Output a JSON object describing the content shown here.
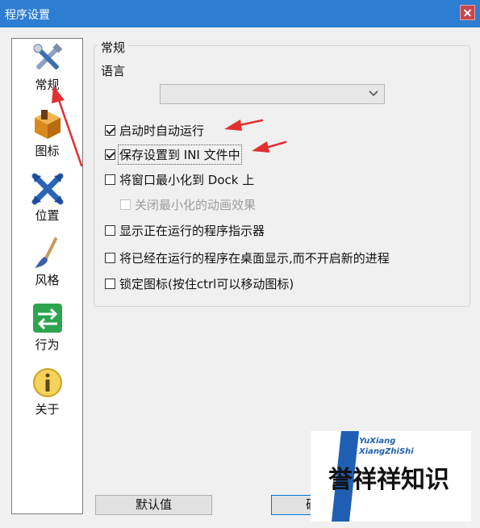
{
  "window": {
    "title": "程序设置"
  },
  "sidebar": {
    "items": [
      {
        "label": "常规",
        "icon": "tools-icon",
        "selected": true
      },
      {
        "label": "图标",
        "icon": "box-icon",
        "selected": false
      },
      {
        "label": "位置",
        "icon": "position-icon",
        "selected": false
      },
      {
        "label": "风格",
        "icon": "brush-icon",
        "selected": false
      },
      {
        "label": "行为",
        "icon": "arrows-icon",
        "selected": false
      },
      {
        "label": "关于",
        "icon": "info-icon",
        "selected": false
      }
    ]
  },
  "general": {
    "group_title": "常规",
    "language_label": "语言",
    "language_value": "",
    "options": [
      {
        "label": "启动时自动运行",
        "checked": true,
        "disabled": false
      },
      {
        "label": "保存设置到 INI 文件中",
        "checked": true,
        "disabled": false
      },
      {
        "label": "将窗口最小化到 Dock 上",
        "checked": false,
        "disabled": false
      },
      {
        "label": "关闭最小化的动画效果",
        "checked": false,
        "disabled": true
      },
      {
        "label": "显示正在运行的程序指示器",
        "checked": false,
        "disabled": false
      },
      {
        "label": "将已经在运行的程序在桌面显示,而不开启新的进程",
        "checked": false,
        "disabled": false
      },
      {
        "label": "锁定图标(按住ctrl可以移动图标)",
        "checked": false,
        "disabled": false
      }
    ]
  },
  "buttons": {
    "default_label": "默认值",
    "ok_label": "确"
  },
  "watermark": {
    "line1": "YuXiang",
    "line2": "XiangZhiShi",
    "brand": "誉祥祥知识"
  },
  "colors": {
    "titlebar": "#2d7dd2",
    "annotation": "#e03030",
    "brand_blue": "#1e5fb4"
  }
}
